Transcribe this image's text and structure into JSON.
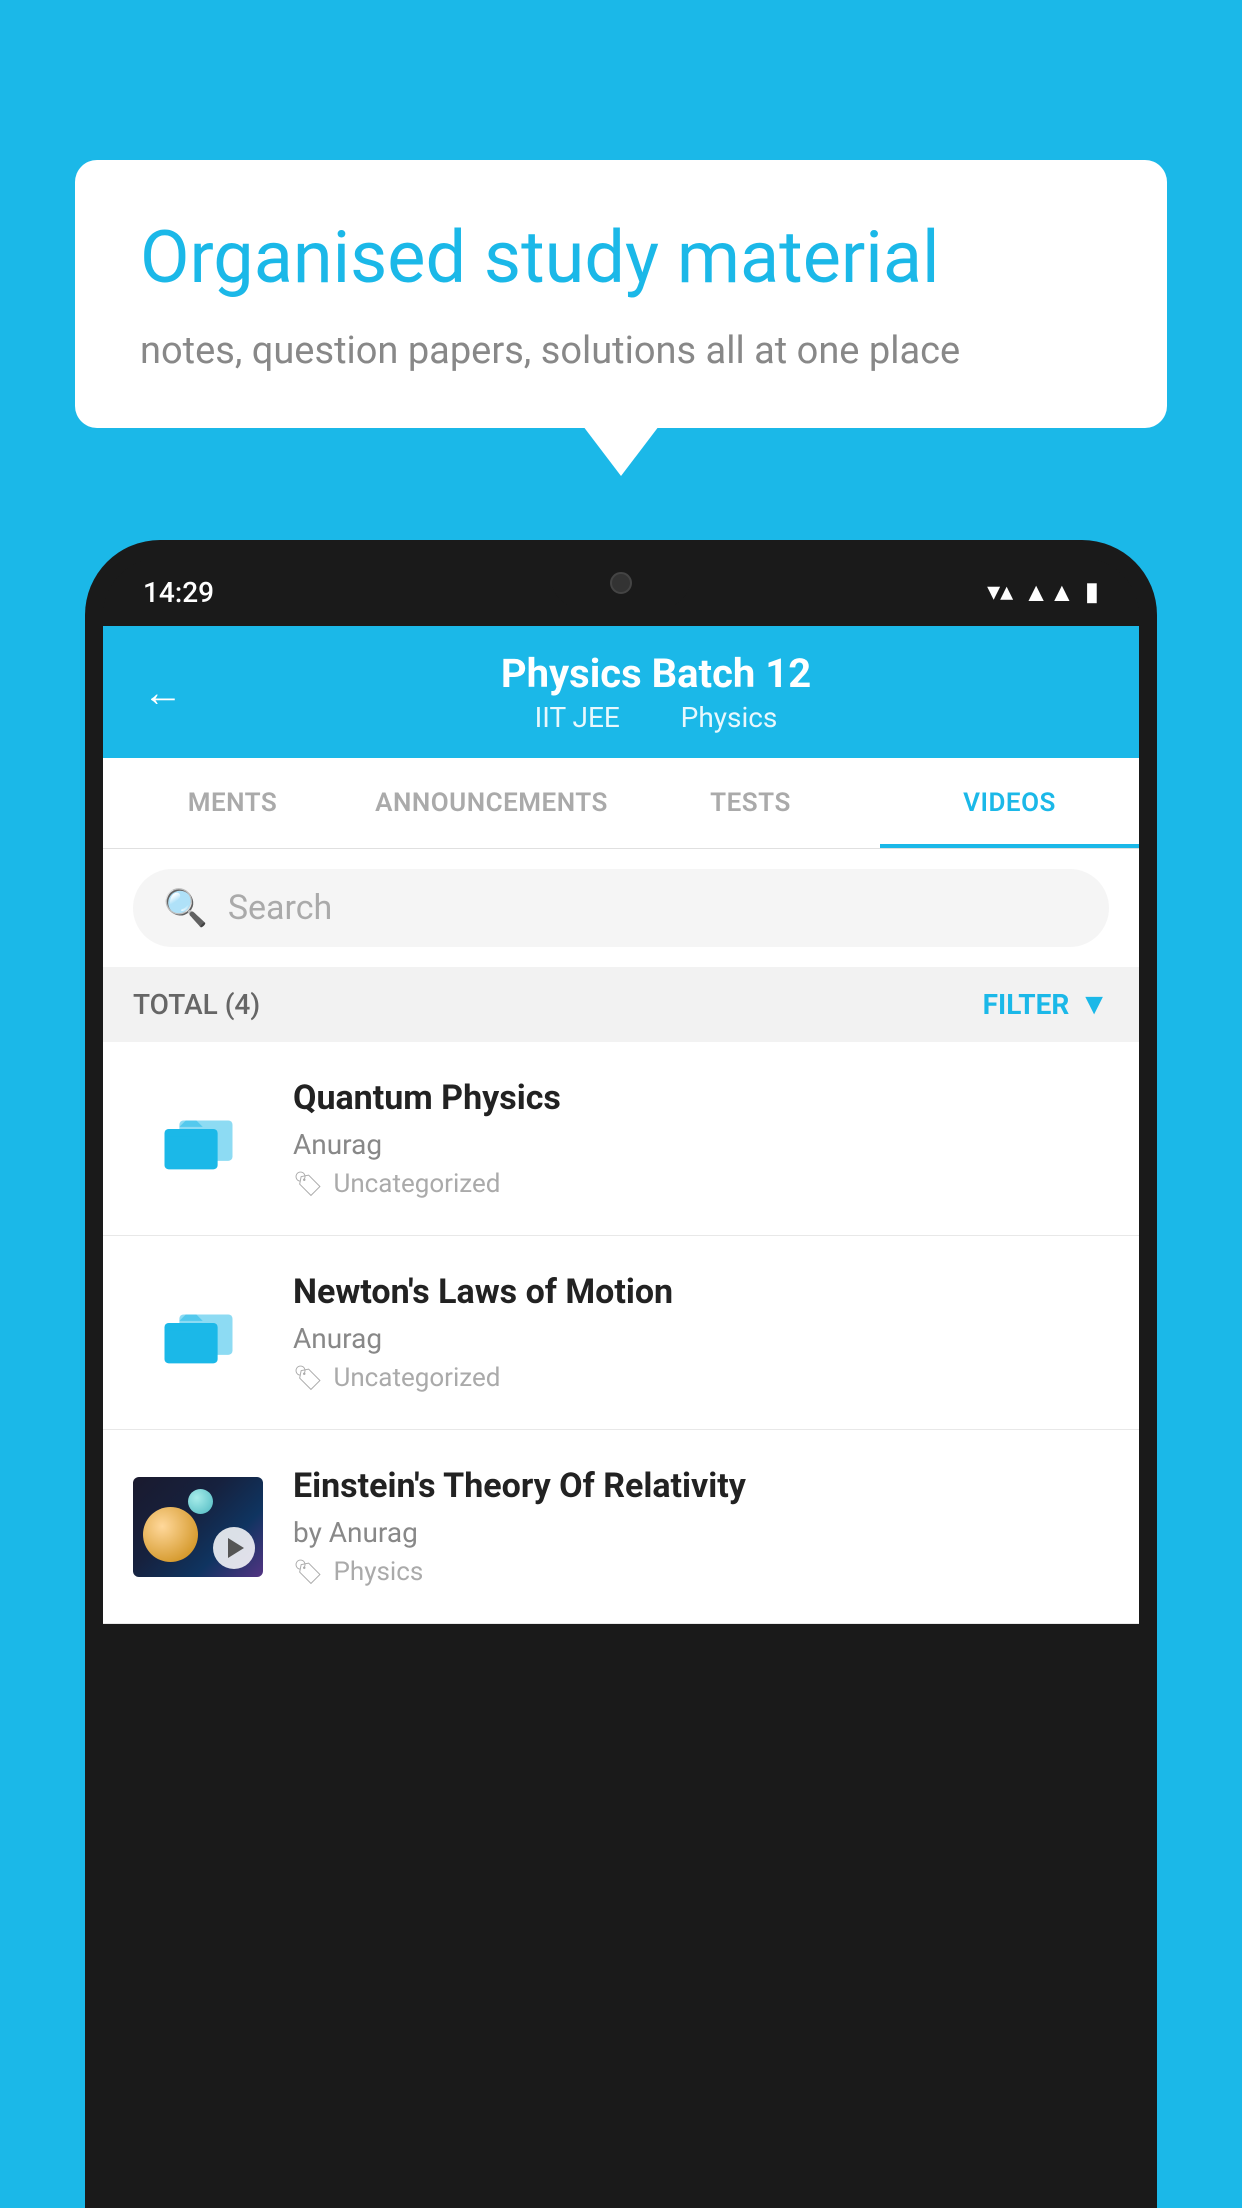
{
  "background_color": "#1BB8E8",
  "bubble": {
    "title": "Organised study material",
    "subtitle": "notes, question papers, solutions all at one place"
  },
  "phone": {
    "time": "14:29",
    "header": {
      "title": "Physics Batch 12",
      "subtitle_part1": "IIT JEE",
      "subtitle_part2": "Physics"
    },
    "tabs": [
      {
        "label": "MENTS",
        "active": false
      },
      {
        "label": "ANNOUNCEMENTS",
        "active": false
      },
      {
        "label": "TESTS",
        "active": false
      },
      {
        "label": "VIDEOS",
        "active": true
      }
    ],
    "search": {
      "placeholder": "Search"
    },
    "filter": {
      "total_label": "TOTAL (4)",
      "filter_label": "FILTER"
    },
    "videos": [
      {
        "id": 1,
        "title": "Quantum Physics",
        "author": "Anurag",
        "tag": "Uncategorized",
        "type": "folder",
        "has_thumbnail": false
      },
      {
        "id": 2,
        "title": "Newton's Laws of Motion",
        "author": "Anurag",
        "tag": "Uncategorized",
        "type": "folder",
        "has_thumbnail": false
      },
      {
        "id": 3,
        "title": "Einstein's Theory Of Relativity",
        "author": "by Anurag",
        "tag": "Physics",
        "type": "video",
        "has_thumbnail": true
      }
    ]
  }
}
